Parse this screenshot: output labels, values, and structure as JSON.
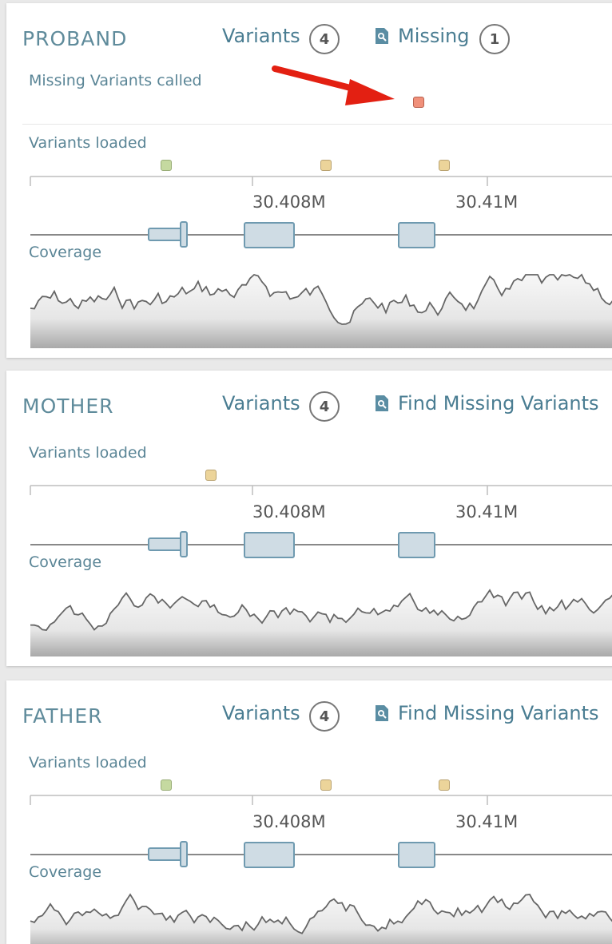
{
  "colors": {
    "accent": "#4a7d92",
    "variant_green": "#c5d9a0",
    "variant_yellow": "#ecd49a",
    "missing_variant": "#f0907a",
    "arrow": "#e32012",
    "exon_fill": "#cfdce4",
    "exon_stroke": "#6f9ab0"
  },
  "panels": [
    {
      "title": "PROBAND",
      "variants_label": "Variants",
      "variants_count": "4",
      "missing_label": "Missing",
      "missing_count": "1",
      "missing_variants_label": "Missing Variants called",
      "variants_loaded_label": "Variants loaded",
      "coverage_label": "Coverage",
      "ticks": [
        "30.408M",
        "30.41M"
      ]
    },
    {
      "title": "MOTHER",
      "variants_label": "Variants",
      "variants_count": "4",
      "missing_label": "Find Missing Variants",
      "variants_loaded_label": "Variants loaded",
      "coverage_label": "Coverage",
      "ticks": [
        "30.408M",
        "30.41M"
      ]
    },
    {
      "title": "FATHER",
      "variants_label": "Variants",
      "variants_count": "4",
      "missing_label": "Find Missing Variants",
      "variants_loaded_label": "Variants loaded",
      "coverage_label": "Coverage",
      "ticks": [
        "30.408M",
        "30.41M"
      ]
    }
  ],
  "icons": {
    "find_missing": "magnifier-doc-icon",
    "callout": "red-arrow-icon"
  }
}
